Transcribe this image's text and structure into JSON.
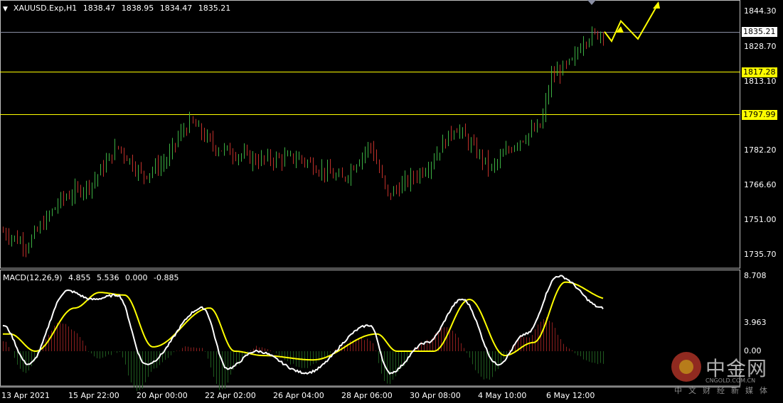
{
  "header": {
    "symbol": "XAUUSD.Exp,H1",
    "open": "1838.47",
    "high": "1838.95",
    "low": "1834.47",
    "close": "1835.21"
  },
  "macd_header": {
    "name": "MACD(12,26,9)",
    "v1": "4.855",
    "v2": "5.536",
    "v3": "0.000",
    "v4": "-0.885"
  },
  "price_axis": {
    "ticks": [
      "1844.30",
      "1828.70",
      "1813.10",
      "1782.20",
      "1766.60",
      "1751.00",
      "1735.70"
    ],
    "current_price": "1835.21",
    "levels": [
      "1817.28",
      "1797.99"
    ],
    "level_color": "#ffff00"
  },
  "macd_axis": {
    "top": "8.708",
    "mid": "3.963",
    "zero": "0.00"
  },
  "time_axis": [
    "13 Apr 2021",
    "15 Apr 22:00",
    "20 Apr 00:00",
    "22 Apr 02:00",
    "26 Apr 04:00",
    "28 Apr 06:00",
    "30 Apr 08:00",
    "4 May 10:00",
    "6 May 12:00"
  ],
  "colors": {
    "bull": "#3cb043",
    "bear": "#c0302a",
    "signal": "#ffff00",
    "macd": "#ffffff",
    "hist_pos": "#8b1e1e",
    "hist_neg": "#1f5a1f"
  },
  "watermark": {
    "brand_cn": "中金网",
    "url": "CNGOLD.COM.CN",
    "tagline": "中文财经新媒体"
  },
  "chart_data": {
    "type": "candlestick",
    "anchors": [
      {
        "time": "13 Apr 2021",
        "price": 1746
      },
      {
        "time": "14 Apr",
        "price": 1740
      },
      {
        "time": "15 Apr 06:00",
        "price": 1760
      },
      {
        "time": "15 Apr 22:00",
        "price": 1768
      },
      {
        "time": "16 Apr",
        "price": 1784
      },
      {
        "time": "18 Apr",
        "price": 1788
      },
      {
        "time": "20 Apr 00:00",
        "price": 1771
      },
      {
        "time": "21 Apr",
        "price": 1778
      },
      {
        "time": "22 Apr 02:00",
        "price": 1795
      },
      {
        "time": "23 Apr",
        "price": 1784
      },
      {
        "time": "26 Apr 04:00",
        "price": 1778
      },
      {
        "time": "27 Apr",
        "price": 1779
      },
      {
        "time": "28 Apr 06:00",
        "price": 1769
      },
      {
        "time": "28 Apr 18:00",
        "price": 1785
      },
      {
        "time": "29 Apr",
        "price": 1762
      },
      {
        "time": "30 Apr 08:00",
        "price": 1775
      },
      {
        "time": "3 May",
        "price": 1793
      },
      {
        "time": "4 May 10:00",
        "price": 1774
      },
      {
        "time": "5 May",
        "price": 1786
      },
      {
        "time": "6 May 00:00",
        "price": 1793
      },
      {
        "time": "6 May 04:00",
        "price": 1815
      },
      {
        "time": "6 May 12:00",
        "price": 1822
      },
      {
        "time": "6 May 18:00",
        "price": 1832
      },
      {
        "time": "7 May",
        "price": 1835.21
      }
    ],
    "macd_anchors": [
      {
        "time": "13 Apr 2021",
        "macd": 3.0,
        "signal": 2.0
      },
      {
        "time": "14 Apr",
        "macd": -1.5,
        "signal": 0.0
      },
      {
        "time": "15 Apr 06:00",
        "macd": 7.0,
        "signal": 5.0
      },
      {
        "time": "15 Apr 22:00",
        "macd": 6.0,
        "signal": 6.8
      },
      {
        "time": "17 Apr",
        "macd": 6.5,
        "signal": 6.5
      },
      {
        "time": "20 Apr 00:00",
        "macd": -1.5,
        "signal": 0.5
      },
      {
        "time": "22 Apr 02:00",
        "macd": 5.0,
        "signal": 5.0
      },
      {
        "time": "23 Apr",
        "macd": -2.0,
        "signal": 0.0
      },
      {
        "time": "26 Apr 04:00",
        "macd": 0.0,
        "signal": -0.5
      },
      {
        "time": "28 Apr 06:00",
        "macd": -2.5,
        "signal": -1.0
      },
      {
        "time": "28 Apr 18:00",
        "macd": 3.0,
        "signal": 2.0
      },
      {
        "time": "29 Apr",
        "macd": -2.5,
        "signal": 0.0
      },
      {
        "time": "30 Apr 08:00",
        "macd": 1.0,
        "signal": 0.0
      },
      {
        "time": "3 May",
        "macd": 6.0,
        "signal": 6.0
      },
      {
        "time": "4 May 10:00",
        "macd": -1.5,
        "signal": -0.5
      },
      {
        "time": "5 May",
        "macd": 2.0,
        "signal": 1.0
      },
      {
        "time": "6 May 12:00",
        "macd": 8.7,
        "signal": 8.0
      },
      {
        "time": "7 May",
        "macd": 5.0,
        "signal": 6.0
      }
    ],
    "forecast_path": [
      1835.21,
      1831,
      1840,
      1832,
      1848
    ]
  }
}
